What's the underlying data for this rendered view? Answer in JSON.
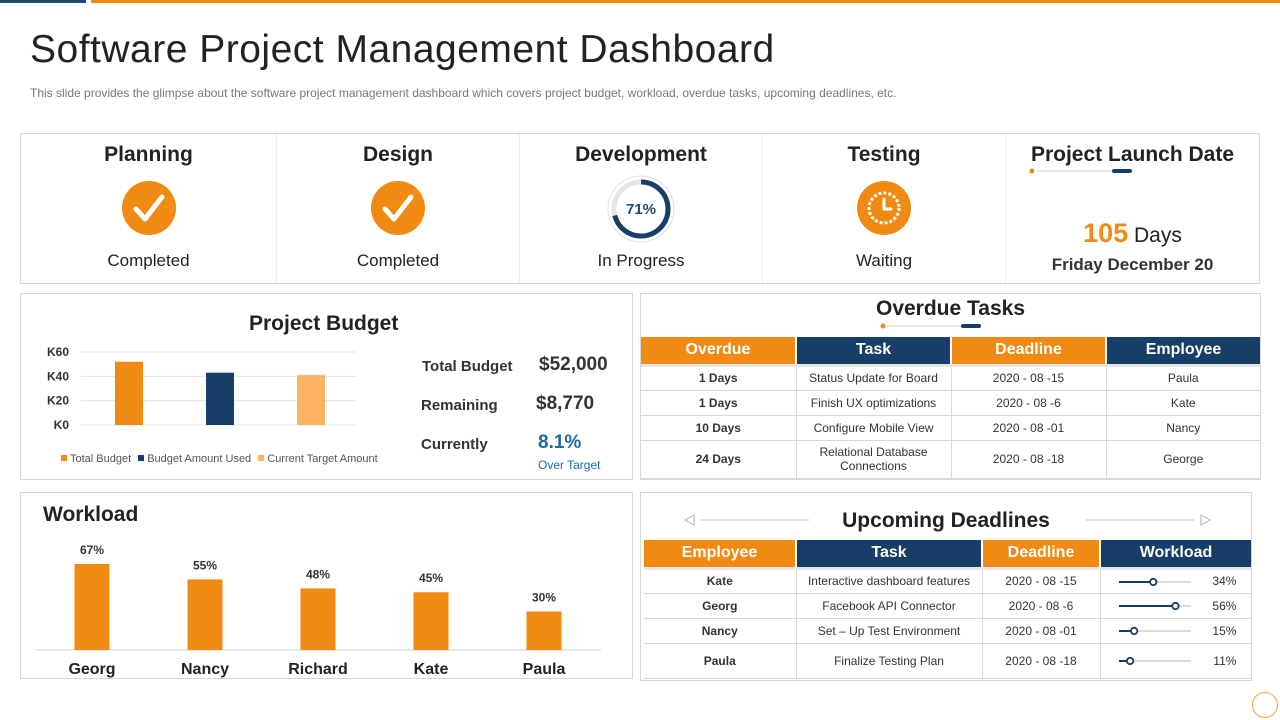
{
  "header": {
    "title": "Software Project Management Dashboard",
    "subtitle": "This slide provides the glimpse about the software project management dashboard which covers project budget, workload, overdue tasks, upcoming deadlines, etc."
  },
  "stages": [
    {
      "title": "Planning",
      "status": "Completed",
      "icon": "check-icon"
    },
    {
      "title": "Design",
      "status": "Completed",
      "icon": "check-icon"
    },
    {
      "title": "Development",
      "status": "In Progress",
      "icon": "progress-ring",
      "progress_label": "71%",
      "progress": 0.71
    },
    {
      "title": "Testing",
      "status": "Waiting",
      "icon": "clock-icon"
    }
  ],
  "launch": {
    "title": "Project Launch Date",
    "days_number": "105",
    "days_unit": "Days",
    "date": "Friday December 20"
  },
  "budget": {
    "title": "Project Budget",
    "total_label": "Total Budget",
    "total_value": "$52,000",
    "remaining_label": "Remaining",
    "remaining_value": "$8,770",
    "currently_label": "Currently",
    "currently_value": "8.1%",
    "currently_note": "Over Target"
  },
  "chart_data": [
    {
      "type": "bar",
      "title": "Project Budget",
      "y_ticks": [
        "K0",
        "K20",
        "K40",
        "K60"
      ],
      "ylim": [
        0,
        60
      ],
      "categories": [
        "Total Budget",
        "Budget Amount Used",
        "Current Target Amount"
      ],
      "values": [
        52,
        43,
        41
      ],
      "colors": [
        "#f08a12",
        "#173e66",
        "#fdb462"
      ],
      "legend": [
        "Total Budget",
        "Budget Amount Used",
        "Current Target Amount"
      ],
      "legend_position": "bottom",
      "grid": true
    },
    {
      "type": "bar",
      "title": "Workload",
      "categories": [
        "Georg",
        "Nancy",
        "Richard",
        "Kate",
        "Paula"
      ],
      "values": [
        67,
        55,
        48,
        45,
        30
      ],
      "value_labels": [
        "67%",
        "55%",
        "48%",
        "45%",
        "30%"
      ],
      "ylim": [
        0,
        70
      ],
      "color": "#f08a12"
    }
  ],
  "overdue": {
    "title": "Overdue Tasks",
    "columns": [
      "Overdue",
      "Task",
      "Deadline",
      "Employee"
    ],
    "rows": [
      [
        "1 Days",
        "Status Update for Board",
        "2020 - 08 -15",
        "Paula"
      ],
      [
        "1 Days",
        "Finish UX optimizations",
        "2020 - 08 -6",
        "Kate"
      ],
      [
        "10 Days",
        "Configure Mobile View",
        "2020 - 08 -01",
        "Nancy"
      ],
      [
        "24 Days",
        "Relational Database Connections",
        "2020 - 08 -18",
        "George"
      ]
    ]
  },
  "deadlines": {
    "title": "Upcoming Deadlines",
    "columns": [
      "Employee",
      "Task",
      "Deadline",
      "Workload"
    ],
    "rows": [
      [
        "Kate",
        "Interactive dashboard features",
        "2020 - 08 -15",
        "34%"
      ],
      [
        "Georg",
        "Facebook API Connector",
        "2020 - 08 -6",
        "56%"
      ],
      [
        "Nancy",
        "Set – Up Test Environment",
        "2020 - 08 -01",
        "15%"
      ],
      [
        "Paula",
        "Finalize Testing Plan",
        "2020 - 08 -18",
        "11%"
      ]
    ],
    "workload_values": [
      0.34,
      0.56,
      0.15,
      0.11
    ]
  },
  "colors": {
    "accent": "#f08a12",
    "navy": "#173e66",
    "light_orange": "#fdb462"
  }
}
